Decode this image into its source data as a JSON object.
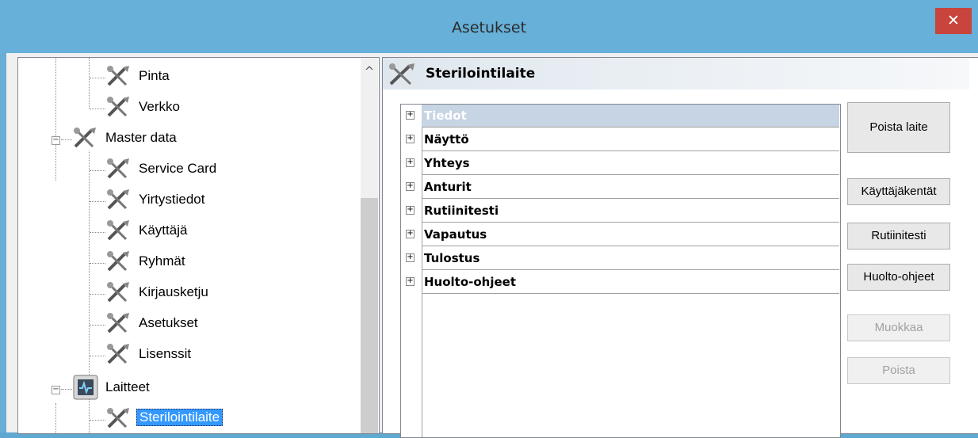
{
  "window": {
    "title": "Asetukset"
  },
  "tree": {
    "items": [
      {
        "label": "Pinta",
        "icon": "tools-icon"
      },
      {
        "label": "Verkko",
        "icon": "tools-icon"
      },
      {
        "label": "Master data",
        "icon": "tools-icon"
      },
      {
        "label": "Service Card",
        "icon": "tools-icon"
      },
      {
        "label": "Yirtystiedot",
        "icon": "tools-icon"
      },
      {
        "label": "Käyttäjä",
        "icon": "tools-icon"
      },
      {
        "label": "Ryhmät",
        "icon": "tools-icon"
      },
      {
        "label": "Kirjausketju",
        "icon": "tools-icon"
      },
      {
        "label": "Asetukset",
        "icon": "tools-icon"
      },
      {
        "label": "Lisenssit",
        "icon": "tools-icon"
      },
      {
        "label": "Laitteet",
        "icon": "device-monitor-icon"
      },
      {
        "label": "Sterilointilaite",
        "icon": "tools-icon"
      }
    ]
  },
  "panel": {
    "title": "Sterilointilaite",
    "sections": [
      "Tiedot",
      "Näyttö",
      "Yhteys",
      "Anturit",
      "Rutiinitesti",
      "Vapautus",
      "Tulostus",
      "Huolto-ohjeet"
    ],
    "buttons": {
      "remove_device": "Poista laite",
      "user_fields": "Käyttäjäkentät",
      "routine_test": "Rutiinitesti",
      "maintenance": "Huolto-ohjeet",
      "edit": "Muokkaa",
      "delete": "Poista"
    }
  },
  "colors": {
    "titlebar": "#66b0d9",
    "close": "#c8443c",
    "selection": "#3399ff"
  }
}
